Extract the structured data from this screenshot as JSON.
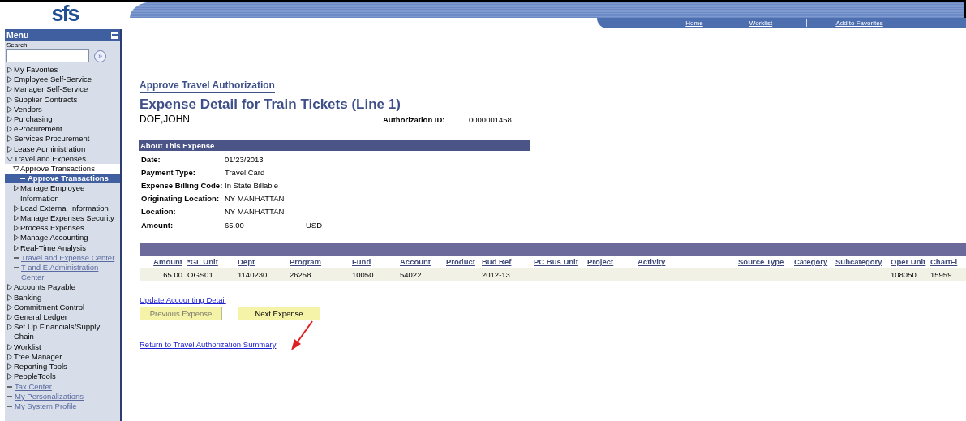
{
  "logo": {
    "text": "sfs"
  },
  "nav_links": [
    "Home",
    "Worklist",
    "Add to Favorites"
  ],
  "menu": {
    "title": "Menu",
    "search_label": "Search:",
    "search_button": "»",
    "items": [
      {
        "label": "My Favorites",
        "kind": "folder",
        "expanded": false,
        "selected": false
      },
      {
        "label": "Employee Self-Service",
        "kind": "folder",
        "expanded": false,
        "selected": false
      },
      {
        "label": "Manager Self-Service",
        "kind": "folder",
        "expanded": false,
        "selected": false
      },
      {
        "label": "Supplier Contracts",
        "kind": "folder",
        "expanded": false,
        "selected": false
      },
      {
        "label": "Vendors",
        "kind": "folder",
        "expanded": false,
        "selected": false
      },
      {
        "label": "Purchasing",
        "kind": "folder",
        "expanded": false,
        "selected": false
      },
      {
        "label": "eProcurement",
        "kind": "folder",
        "expanded": false,
        "selected": false
      },
      {
        "label": "Services Procurement",
        "kind": "folder",
        "expanded": false,
        "selected": false
      },
      {
        "label": "Lease Administration",
        "kind": "folder",
        "expanded": false,
        "selected": false
      },
      {
        "label": "Travel and Expenses",
        "kind": "folder",
        "expanded": true,
        "selected": false,
        "children": [
          {
            "label": "Approve Transactions",
            "kind": "folder",
            "expanded": true,
            "selected": false,
            "children": [
              {
                "label": "Approve Transactions",
                "kind": "current",
                "selected": true
              }
            ]
          },
          {
            "label": "Manage Employee Information",
            "kind": "folder",
            "expanded": false,
            "selected": false
          },
          {
            "label": "Load External Information",
            "kind": "folder",
            "expanded": false,
            "selected": false
          },
          {
            "label": "Manage Expenses Security",
            "kind": "folder",
            "expanded": false,
            "selected": false
          },
          {
            "label": "Process Expenses",
            "kind": "folder",
            "expanded": false,
            "selected": false
          },
          {
            "label": "Manage Accounting",
            "kind": "folder",
            "expanded": false,
            "selected": false
          },
          {
            "label": "Real-Time Analysis",
            "kind": "folder",
            "expanded": false,
            "selected": false
          },
          {
            "label": "Travel and Expense Center",
            "kind": "link",
            "selected": false
          },
          {
            "label": "T and E Administration Center",
            "kind": "link",
            "selected": false
          }
        ]
      },
      {
        "label": "Accounts Payable",
        "kind": "folder",
        "expanded": false,
        "selected": false
      },
      {
        "label": "Banking",
        "kind": "folder",
        "expanded": false,
        "selected": false
      },
      {
        "label": "Commitment Control",
        "kind": "folder",
        "expanded": false,
        "selected": false
      },
      {
        "label": "General Ledger",
        "kind": "folder",
        "expanded": false,
        "selected": false
      },
      {
        "label": "Set Up Financials/Supply Chain",
        "kind": "folder",
        "expanded": false,
        "selected": false
      },
      {
        "label": "Worklist",
        "kind": "folder",
        "expanded": false,
        "selected": false
      },
      {
        "label": "Tree Manager",
        "kind": "folder",
        "expanded": false,
        "selected": false
      },
      {
        "label": "Reporting Tools",
        "kind": "folder",
        "expanded": false,
        "selected": false
      },
      {
        "label": "PeopleTools",
        "kind": "folder",
        "expanded": false,
        "selected": false
      },
      {
        "label": "Tax Center",
        "kind": "link",
        "selected": false
      },
      {
        "label": "My Personalizations",
        "kind": "link",
        "selected": false
      },
      {
        "label": "My System Profile",
        "kind": "link",
        "selected": false
      }
    ]
  },
  "breadcrumb": "Approve Travel Authorization",
  "title": "Expense Detail for Train Tickets (Line 1)",
  "employee": "DOE,JOHN",
  "authorization": {
    "label": "Authorization ID:",
    "value": "0000001458"
  },
  "about": {
    "heading": "About This Expense",
    "fields": [
      {
        "label": "Date:",
        "value": "01/23/2013"
      },
      {
        "label": "Payment Type:",
        "value": "Travel Card"
      },
      {
        "label": "Expense Billing Code:",
        "value": "In State Billable"
      },
      {
        "label": "Originating Location:",
        "value": "NY MANHATTAN"
      },
      {
        "label": "Location:",
        "value": "NY MANHATTAN"
      },
      {
        "label": "Amount:",
        "value": "65.00",
        "currency": "USD"
      }
    ]
  },
  "accounting": {
    "columns": [
      "Amount",
      "*GL Unit",
      "Dept",
      "Program",
      "Fund",
      "Account",
      "Product",
      "Bud Ref",
      "PC Bus Unit",
      "Project",
      "Activity",
      "Source Type",
      "Category",
      "Subcategory",
      "Oper Unit",
      "ChartFi"
    ],
    "rows": [
      [
        "65.00",
        "OGS01",
        "1140230",
        "26258",
        "10050",
        "54022",
        "",
        "2012-13",
        "",
        "",
        "",
        "",
        "",
        "",
        "108050",
        "15959"
      ]
    ]
  },
  "update_link": "Update Accounting Detail",
  "buttons": [
    {
      "label": "Previous Expense",
      "disabled": true
    },
    {
      "label": "Next Expense",
      "disabled": false
    }
  ],
  "return_link": "Return to Travel Authorization Summary"
}
